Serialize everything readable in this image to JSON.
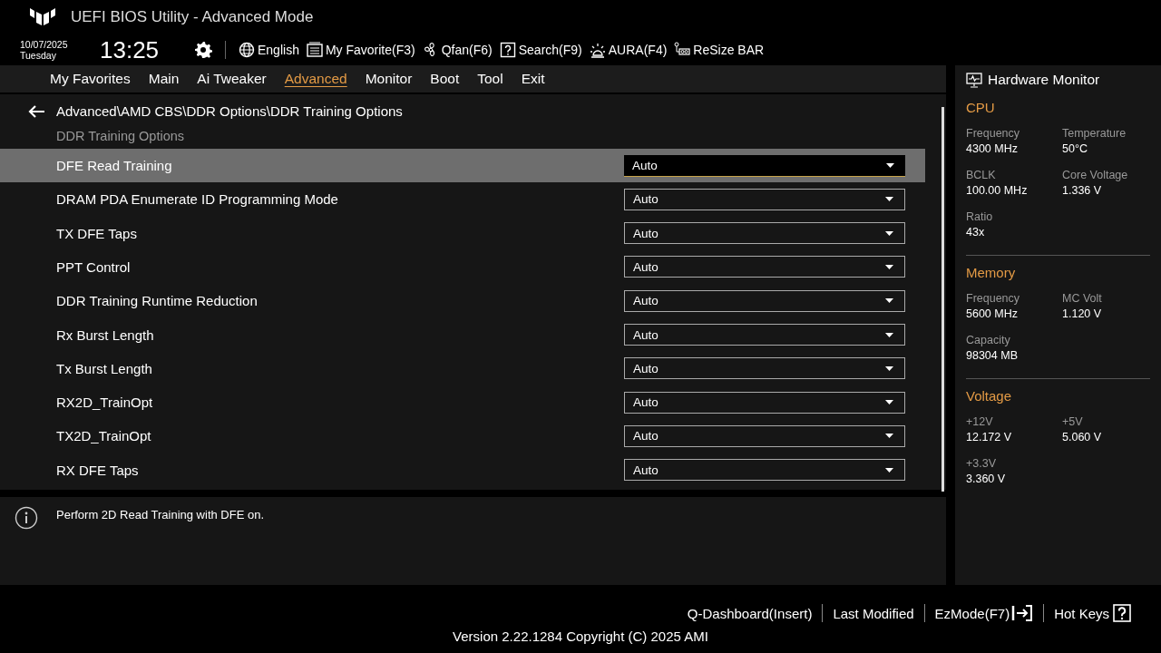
{
  "header": {
    "title": "UEFI BIOS Utility - Advanced Mode",
    "date": "10/07/2025",
    "day": "Tuesday",
    "time": "13:25",
    "tools": [
      {
        "kind": "globe",
        "label": "English"
      },
      {
        "kind": "favorite",
        "label": "My Favorite(F3)"
      },
      {
        "kind": "fan",
        "label": "Qfan(F6)"
      },
      {
        "kind": "search",
        "label": "Search(F9)"
      },
      {
        "kind": "aura",
        "label": "AURA(F4)"
      },
      {
        "kind": "resize",
        "label": "ReSize BAR"
      }
    ]
  },
  "tabs": [
    {
      "label": "My Favorites",
      "selected": false
    },
    {
      "label": "Main",
      "selected": false
    },
    {
      "label": "Ai Tweaker",
      "selected": false
    },
    {
      "label": "Advanced",
      "selected": true
    },
    {
      "label": "Monitor",
      "selected": false
    },
    {
      "label": "Boot",
      "selected": false
    },
    {
      "label": "Tool",
      "selected": false
    },
    {
      "label": "Exit",
      "selected": false
    }
  ],
  "breadcrumb": "Advanced\\AMD CBS\\DDR Options\\DDR Training Options",
  "section_title": "DDR Training Options",
  "settings": [
    {
      "label": "DFE Read Training",
      "value": "Auto",
      "selected": true
    },
    {
      "label": "DRAM PDA Enumerate ID Programming Mode",
      "value": "Auto",
      "selected": false
    },
    {
      "label": "TX DFE Taps",
      "value": "Auto",
      "selected": false
    },
    {
      "label": "PPT Control",
      "value": "Auto",
      "selected": false
    },
    {
      "label": "DDR Training Runtime Reduction",
      "value": "Auto",
      "selected": false
    },
    {
      "label": "Rx Burst Length",
      "value": "Auto",
      "selected": false
    },
    {
      "label": "Tx Burst Length",
      "value": "Auto",
      "selected": false
    },
    {
      "label": "RX2D_TrainOpt",
      "value": "Auto",
      "selected": false
    },
    {
      "label": "TX2D_TrainOpt",
      "value": "Auto",
      "selected": false
    },
    {
      "label": "RX DFE Taps",
      "value": "Auto",
      "selected": false
    }
  ],
  "help_text": "Perform 2D Read Training with DFE on.",
  "hardware_monitor": {
    "title": "Hardware Monitor",
    "sections": [
      {
        "title": "CPU",
        "items": [
          {
            "label": "Frequency",
            "value": "4300 MHz"
          },
          {
            "label": "Temperature",
            "value": "50°C"
          },
          {
            "label": "BCLK",
            "value": "100.00 MHz"
          },
          {
            "label": "Core Voltage",
            "value": "1.336 V"
          },
          {
            "label": "Ratio",
            "value": "43x"
          }
        ]
      },
      {
        "title": "Memory",
        "items": [
          {
            "label": "Frequency",
            "value": "5600 MHz"
          },
          {
            "label": "MC Volt",
            "value": "1.120 V"
          },
          {
            "label": "Capacity",
            "value": "98304 MB"
          }
        ]
      },
      {
        "title": "Voltage",
        "items": [
          {
            "label": "+12V",
            "value": "12.172 V"
          },
          {
            "label": "+5V",
            "value": "5.060 V"
          },
          {
            "label": "+3.3V",
            "value": "3.360 V"
          }
        ]
      }
    ]
  },
  "footer": {
    "actions": [
      {
        "kind": "plain",
        "label": "Q-Dashboard(Insert)"
      },
      {
        "kind": "plain",
        "label": "Last Modified"
      },
      {
        "kind": "ezmode",
        "label": "EzMode(F7)"
      },
      {
        "kind": "hotkeys",
        "label": "Hot Keys"
      }
    ],
    "version": "Version 2.22.1284 Copyright (C) 2025 AMI"
  }
}
